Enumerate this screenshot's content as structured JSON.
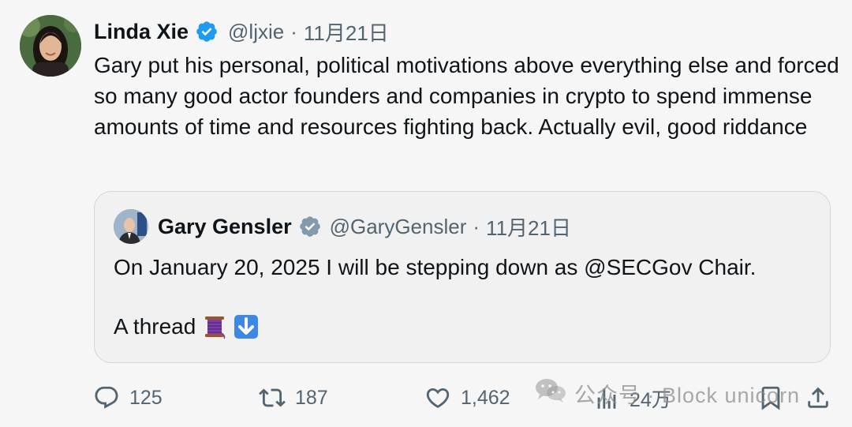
{
  "tweet": {
    "display_name": "Linda Xie",
    "handle": "@ljxie",
    "separator": "·",
    "date": "11月21日",
    "text": "Gary put his personal, political motivations above everything else and forced so many good actor founders and companies in crypto to spend immense amounts of time and resources fighting back. Actually evil, good riddance"
  },
  "quote": {
    "display_name": "Gary Gensler",
    "handle": "@GaryGensler",
    "separator": "·",
    "date": "11月21日",
    "line1": "On January 20, 2025 I will be stepping down as @SECGov Chair.",
    "line2": "A thread"
  },
  "actions": {
    "replies": "125",
    "reposts": "187",
    "likes": "1,462",
    "views": "24万"
  },
  "watermark": {
    "text": "公众号 · Block unicorn"
  },
  "colors": {
    "verified": "#1d9bf0",
    "quote_verified": "#829aab",
    "secondary_text": "#536471",
    "border": "#cfd9de"
  },
  "icons": [
    "verified-badge-icon",
    "reply-icon",
    "repost-icon",
    "like-icon",
    "views-icon",
    "bookmark-icon",
    "share-icon",
    "thread-spool-icon",
    "down-arrow-icon",
    "wechat-icon"
  ]
}
